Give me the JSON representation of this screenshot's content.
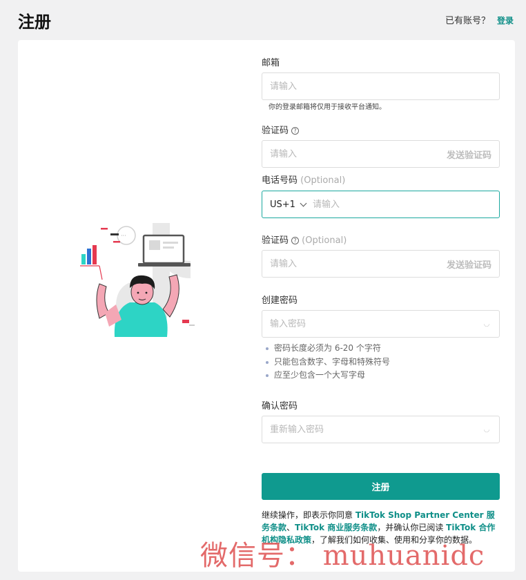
{
  "header": {
    "title": "注册",
    "have_account": "已有账号？",
    "login_link": "登录"
  },
  "form": {
    "email": {
      "label": "邮箱",
      "placeholder": "请输入",
      "hint": "你的登录邮箱将仅用于接收平台通知。"
    },
    "email_code": {
      "label": "验证码",
      "placeholder": "请输入",
      "send_label": "发送验证码"
    },
    "phone": {
      "label": "电话号码",
      "optional": "(Optional)",
      "country_code": "US+1",
      "placeholder": "请输入"
    },
    "phone_code": {
      "label": "验证码",
      "optional": "(Optional)",
      "placeholder": "请输入",
      "send_label": "发送验证码"
    },
    "password": {
      "label": "创建密码",
      "placeholder": "输入密码",
      "rules": [
        "密码长度必须为 6-20 个字符",
        "只能包含数字、字母和特殊符号",
        "应至少包含一个大写字母"
      ]
    },
    "confirm_password": {
      "label": "确认密码",
      "placeholder": "重新输入密码"
    },
    "submit_label": "注册",
    "terms": {
      "p1": "继续操作，即表示你同意 ",
      "link1": "TikTok Shop Partner Center 服务条款",
      "p2": "、",
      "link2": "TikTok 商业服务条款",
      "p3": "，并确认你已阅读 ",
      "link3": "TikTok 合作机构隐私政策",
      "p4": "，了解我们如何收集、使用和分享你的数据。"
    }
  },
  "watermark": "微信号： muhuanidc",
  "colors": {
    "accent": "#0f9a8f",
    "link": "#0f8f88",
    "background": "#f1f1f2"
  }
}
